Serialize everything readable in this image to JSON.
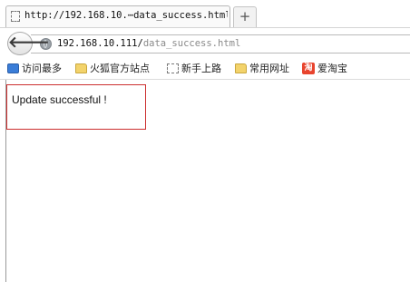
{
  "tab": {
    "title": "http://192.168.10.⋯data_success.html",
    "favicon": "blank-page-icon"
  },
  "newtab": {
    "label": "+"
  },
  "nav": {
    "back_label": "🡐",
    "url_host": "192.168.10.111/",
    "url_path": "data_success.html",
    "site_icon": "globe-icon"
  },
  "bookmarks": [
    {
      "label": "访问最多",
      "icon": "blue-list-icon"
    },
    {
      "label": "火狐官方站点",
      "icon": "folder-icon"
    },
    {
      "label": "新手上路",
      "icon": "blank-page-icon"
    },
    {
      "label": "常用网址",
      "icon": "folder-icon"
    },
    {
      "label": "爱淘宝",
      "icon": "taobao-icon",
      "icon_text": "淘"
    }
  ],
  "content": {
    "message": "Update successful !"
  },
  "colors": {
    "message_border": "#cc2f2f",
    "folder": "#f3d36b",
    "taobao": "#e8442e"
  }
}
